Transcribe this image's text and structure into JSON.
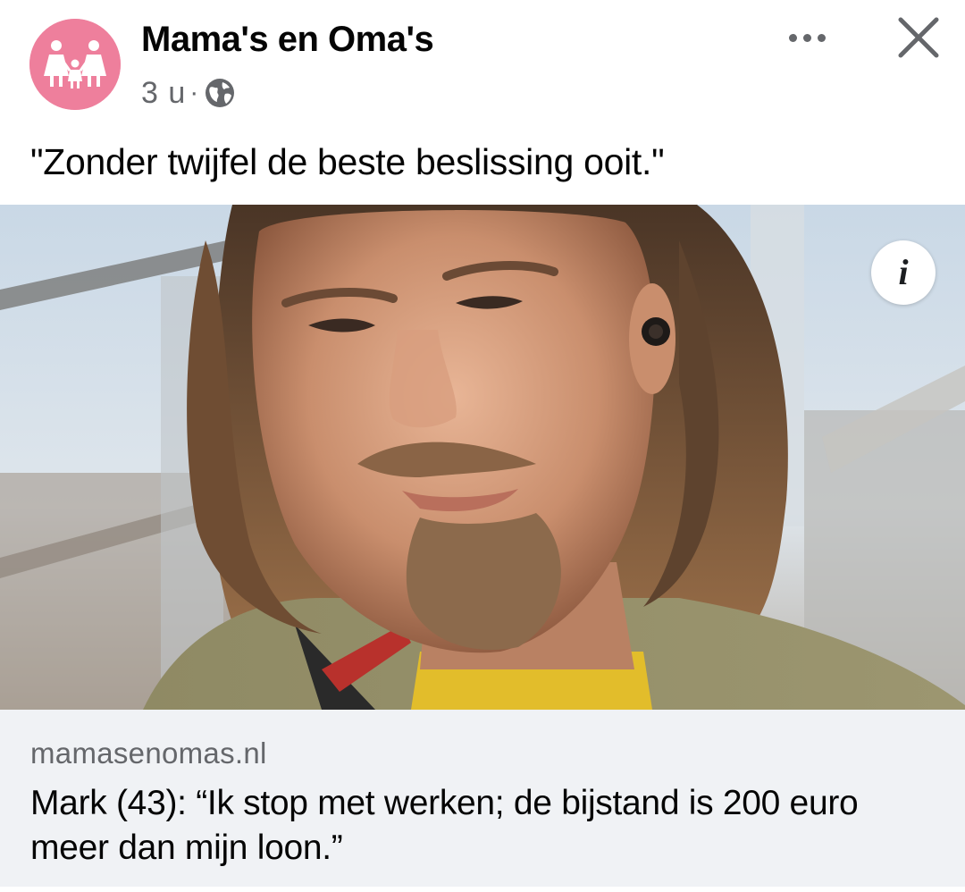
{
  "post": {
    "page_name": "Mama's en Oma's",
    "time": "3 u",
    "separator": "·",
    "audience_icon": "globe-icon",
    "more_icon": "more-horizontal-icon",
    "close_icon": "close-icon",
    "caption": "\"Zonder twijfel de beste beslissing ooit.\""
  },
  "media": {
    "photo_subject": "photo",
    "info_label": "i"
  },
  "link": {
    "domain": "mamasenomas.nl",
    "title": "Mark (43): “Ik stop met werken; de bijstand is 200 euro meer dan mijn loon.”"
  },
  "colors": {
    "avatar_bg": "#ee7f9c",
    "secondary_text": "#65676b",
    "link_bg": "#f0f2f5"
  }
}
